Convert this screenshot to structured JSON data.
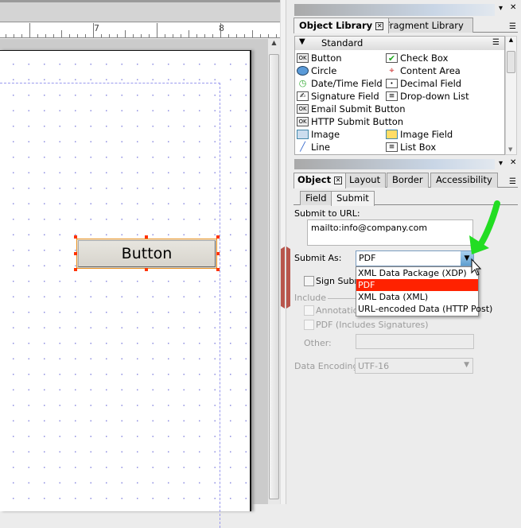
{
  "ruler": {
    "labels": [
      "7",
      "8"
    ]
  },
  "canvas": {
    "button_label": "Button"
  },
  "object_library": {
    "tabs": [
      "Object Library",
      "Fragment Library"
    ],
    "category": "Standard",
    "items_left": [
      "Button",
      "Circle",
      "Date/Time Field",
      "Signature Field",
      "Email Submit Button",
      "HTTP Submit Button",
      "Image",
      "Line"
    ],
    "items_right": [
      "Check Box",
      "Content Area",
      "Decimal Field",
      "Drop-down List",
      "",
      "",
      "Image Field",
      "List Box"
    ]
  },
  "object_panel": {
    "tabs": [
      "Object",
      "Layout",
      "Border",
      "Accessibility"
    ],
    "subtabs": [
      "Field",
      "Submit"
    ],
    "submit_to_url_label": "Submit to URL:",
    "submit_to_url_value": "mailto:info@company.com",
    "submit_as_label": "Submit As:",
    "submit_as_value": "PDF",
    "submit_as_options": [
      "XML Data Package (XDP)",
      "PDF",
      "XML Data (XML)",
      "URL-encoded Data (HTTP Post)"
    ],
    "selected_option": "PDF",
    "sign_submission_label": "Sign Submi",
    "include_label": "Include",
    "annotations_label": "Annotatio",
    "pdf_signatures_label": "PDF (Includes Signatures)",
    "other_label": "Other:",
    "data_encoding_label": "Data Encoding:",
    "data_encoding_value": "UTF-16"
  },
  "colors": {
    "highlight": "#ff2200",
    "arrow": "#22dd22",
    "selection_handles": "#ff3300"
  }
}
